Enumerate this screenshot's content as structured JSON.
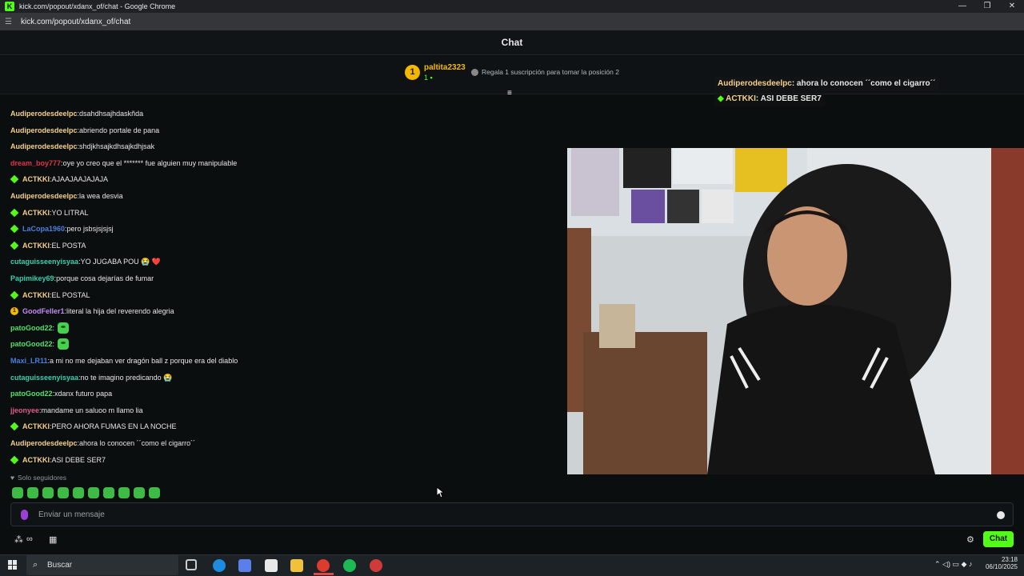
{
  "window": {
    "title": "kick.com/popout/xdanx_of/chat - Google Chrome",
    "url": "kick.com/popout/xdanx_of/chat"
  },
  "header": {
    "title": "Chat"
  },
  "pinned": {
    "rank": "1",
    "user": "paltita2323",
    "count": "1",
    "description": "Regala 1 suscripción para tomar la posición 2"
  },
  "messages": [
    {
      "badge": "",
      "user": "Audiperodesdeelpc",
      "color": "#f5d08a",
      "text": "dsahdhsajhdaskñda"
    },
    {
      "badge": "",
      "user": "Audiperodesdeelpc",
      "color": "#f5d08a",
      "text": "abriendo portale de pana"
    },
    {
      "badge": "",
      "user": "Audiperodesdeelpc",
      "color": "#f5d08a",
      "text": "shdjkhsajkdhsajkdhjsak"
    },
    {
      "badge": "",
      "user": "dream_boy777",
      "color": "#e0334a",
      "text": "oye yo creo que el ******* fue alguien muy manipulable"
    },
    {
      "badge": "diamond",
      "user": "ACTKKI",
      "color": "#f5d08a",
      "text": "AJAAJAAJAJAJA"
    },
    {
      "badge": "",
      "user": "Audiperodesdeelpc",
      "color": "#f5d08a",
      "text": "la wea desvia"
    },
    {
      "badge": "diamond",
      "user": "ACTKKI",
      "color": "#f5d08a",
      "text": "YO LITRAL"
    },
    {
      "badge": "diamond",
      "user": "LaCopa1960",
      "color": "#4a7fe0",
      "text": "pero jsbsjsjsjsj"
    },
    {
      "badge": "diamond",
      "user": "ACTKKI",
      "color": "#f5d08a",
      "text": "EL POSTA"
    },
    {
      "badge": "",
      "user": "cutaguisseenyisyaa",
      "color": "#36d0b0",
      "text": "YO JUGABA POU 😭 ❤️"
    },
    {
      "badge": "",
      "user": "Papimikey69",
      "color": "#36d0b0",
      "text": "porque cosa dejarías de fumar"
    },
    {
      "badge": "diamond",
      "user": "ACTKKI",
      "color": "#f5d08a",
      "text": "EL POSTAL"
    },
    {
      "badge": "sub",
      "user": "GoodFeller1",
      "color": "#c28cf5",
      "text": "literal la hija del reverendo alegria"
    },
    {
      "badge": "",
      "user": "patoGood22",
      "color": "#53e06b",
      "text": "",
      "emote": true
    },
    {
      "badge": "",
      "user": "patoGood22",
      "color": "#53e06b",
      "text": "",
      "emote": true
    },
    {
      "badge": "",
      "user": "Maxi_LR11",
      "color": "#4a7fe0",
      "text": "a mi no me dejaban ver dragón ball z porque era del diablo"
    },
    {
      "badge": "",
      "user": "cutaguisseenyisyaa",
      "color": "#36d0b0",
      "text": "no te imagino predicando 😭"
    },
    {
      "badge": "",
      "user": "patoGood22",
      "color": "#53e06b",
      "text": "xdanx futuro papa"
    },
    {
      "badge": "",
      "user": "jjeonyee",
      "color": "#e05a8a",
      "text": "mandame un saluoo m llamo lia"
    },
    {
      "badge": "diamond",
      "user": "ACTKKI",
      "color": "#f5d08a",
      "text": "PERO AHORA FUMAS EN LA NOCHE"
    },
    {
      "badge": "",
      "user": "Audiperodesdeelpc",
      "color": "#f5d08a",
      "text": "ahora lo conocen ´´como el cigarro´´"
    },
    {
      "badge": "diamond",
      "user": "ACTKKI",
      "color": "#f5d08a",
      "text": "ASI DEBE SER7"
    }
  ],
  "overlay": [
    {
      "user": "Audiperodesdeelpc",
      "text": ": ahora lo conocen ´´como el cigarro´´"
    },
    {
      "user": "ACTKKI",
      "text": ": ASI DEBE SER7"
    }
  ],
  "footer": {
    "followers_only": "Solo seguidores",
    "input_placeholder": "Enviar un mensaje",
    "chat_button": "Chat"
  },
  "taskbar": {
    "search_placeholder": "Buscar",
    "time": "23:18",
    "date": "06/10/2025"
  },
  "colors": {
    "accent": "#53fc18",
    "background": "#0b0e0f"
  }
}
